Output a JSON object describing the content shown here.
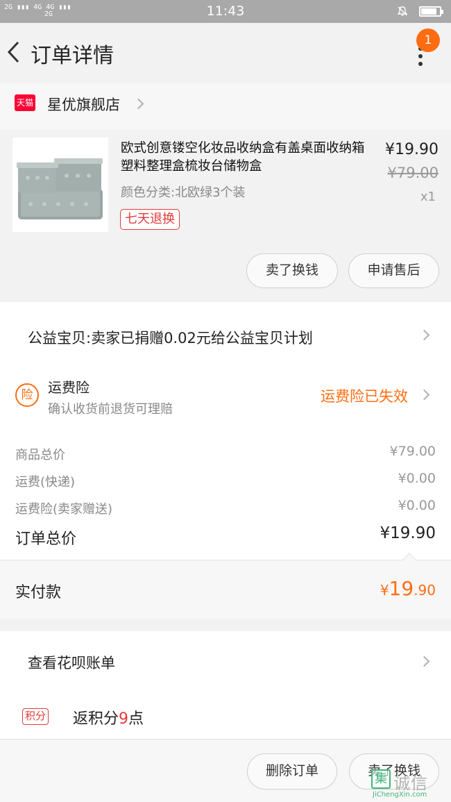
{
  "status_bar": {
    "signal_left": "2G",
    "signal_right": "4G 4G",
    "signal_right2": "2G",
    "time": "11:43",
    "battery_level": 0.85
  },
  "header": {
    "title": "订单详情",
    "notification_count": "1"
  },
  "shop": {
    "badge": "天猫",
    "name": "星优旗舰店"
  },
  "product": {
    "name": "欧式创意镂空化妆品收纳盒有盖桌面收纳箱塑料整理盒梳妆台储物盒",
    "sku": "颜色分类:北欧绿3个装",
    "tag": "七天退换",
    "price": "¥19.90",
    "original_price": "¥79.00",
    "quantity": "x1",
    "buttons": {
      "sell": "卖了换钱",
      "after_sale": "申请售后"
    }
  },
  "charity": {
    "text": "公益宝贝:卖家已捐赠0.02元给公益宝贝计划"
  },
  "insurance": {
    "icon_text": "险",
    "title": "运费险",
    "subtitle": "确认收货前退货可理赔",
    "status": "运费险已失效"
  },
  "costs": {
    "goods_label": "商品总价",
    "goods_value": "¥79.00",
    "shipping_label": "运费(快递)",
    "shipping_value": "¥0.00",
    "insurance_label": "运费险(卖家赠送)",
    "insurance_value": "¥0.00",
    "total_label": "订单总价",
    "total_value": "¥19.90"
  },
  "payment": {
    "label": "实付款",
    "currency": "¥",
    "integer": "19",
    "decimal": ".90"
  },
  "huabei": {
    "text": "查看花呗账单"
  },
  "points": {
    "badge": "积分",
    "prefix": "返积分",
    "value": "9",
    "suffix": "点"
  },
  "bottom_bar": {
    "delete": "删除订单",
    "sell": "卖了换钱"
  },
  "watermark": {
    "box": "集",
    "cn": "诚信",
    "en": "JiChengXin.com"
  },
  "colors": {
    "accent_orange": "#ff6d12",
    "tmall_red": "#ff0036",
    "tag_red": "#e4393c"
  }
}
